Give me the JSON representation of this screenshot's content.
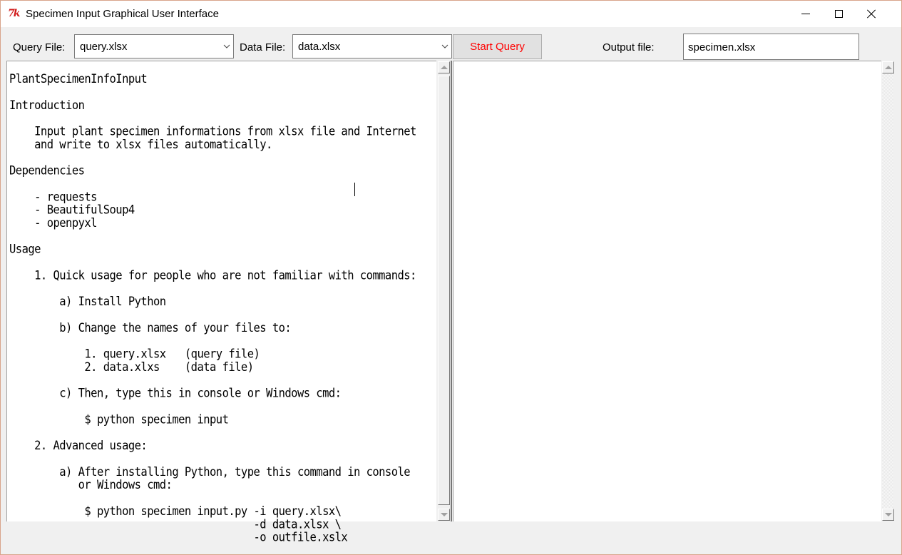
{
  "window": {
    "title": "Specimen Input Graphical User Interface",
    "app_icon": "tk-feather-icon",
    "controls": [
      "minimize",
      "maximize",
      "close"
    ]
  },
  "toolbar": {
    "query_file_label": "Query File:",
    "query_file_value": "query.xlsx",
    "data_file_label": "Data File:",
    "data_file_value": "data.xlsx",
    "start_button_label": "Start Query",
    "start_button_color": "#ff0000",
    "output_file_label": "Output file:",
    "output_file_value": "specimen.xlsx"
  },
  "readme": {
    "lines": [
      "PlantSpecimenInfoInput",
      "",
      "Introduction",
      "",
      "    Input plant specimen informations from xlsx file and Internet",
      "    and write to xlsx files automatically.",
      "",
      "Dependencies",
      "",
      "    - requests",
      "    - BeautifulSoup4",
      "    - openpyxl",
      "",
      "Usage",
      "",
      "    1. Quick usage for people who are not familiar with commands:",
      "",
      "        a) Install Python",
      "",
      "        b) Change the names of your files to:",
      "",
      "            1. query.xlsx   (query file)",
      "            2. data.xlxs    (data file)",
      "",
      "        c) Then, type this in console or Windows cmd:",
      "",
      "            $ python specimen input",
      "",
      "    2. Advanced usage:",
      "",
      "        a) After installing Python, type this command in console",
      "           or Windows cmd:",
      "",
      "            $ python specimen input.py -i query.xlsx\\",
      "                                       -d data.xlsx \\",
      "                                       -o outfile.xslx"
    ]
  },
  "output_panel": {
    "lines": []
  },
  "scroll": {
    "left_panel_visible_fraction": 0.98,
    "left_panel_scroll_position": 0.0
  }
}
